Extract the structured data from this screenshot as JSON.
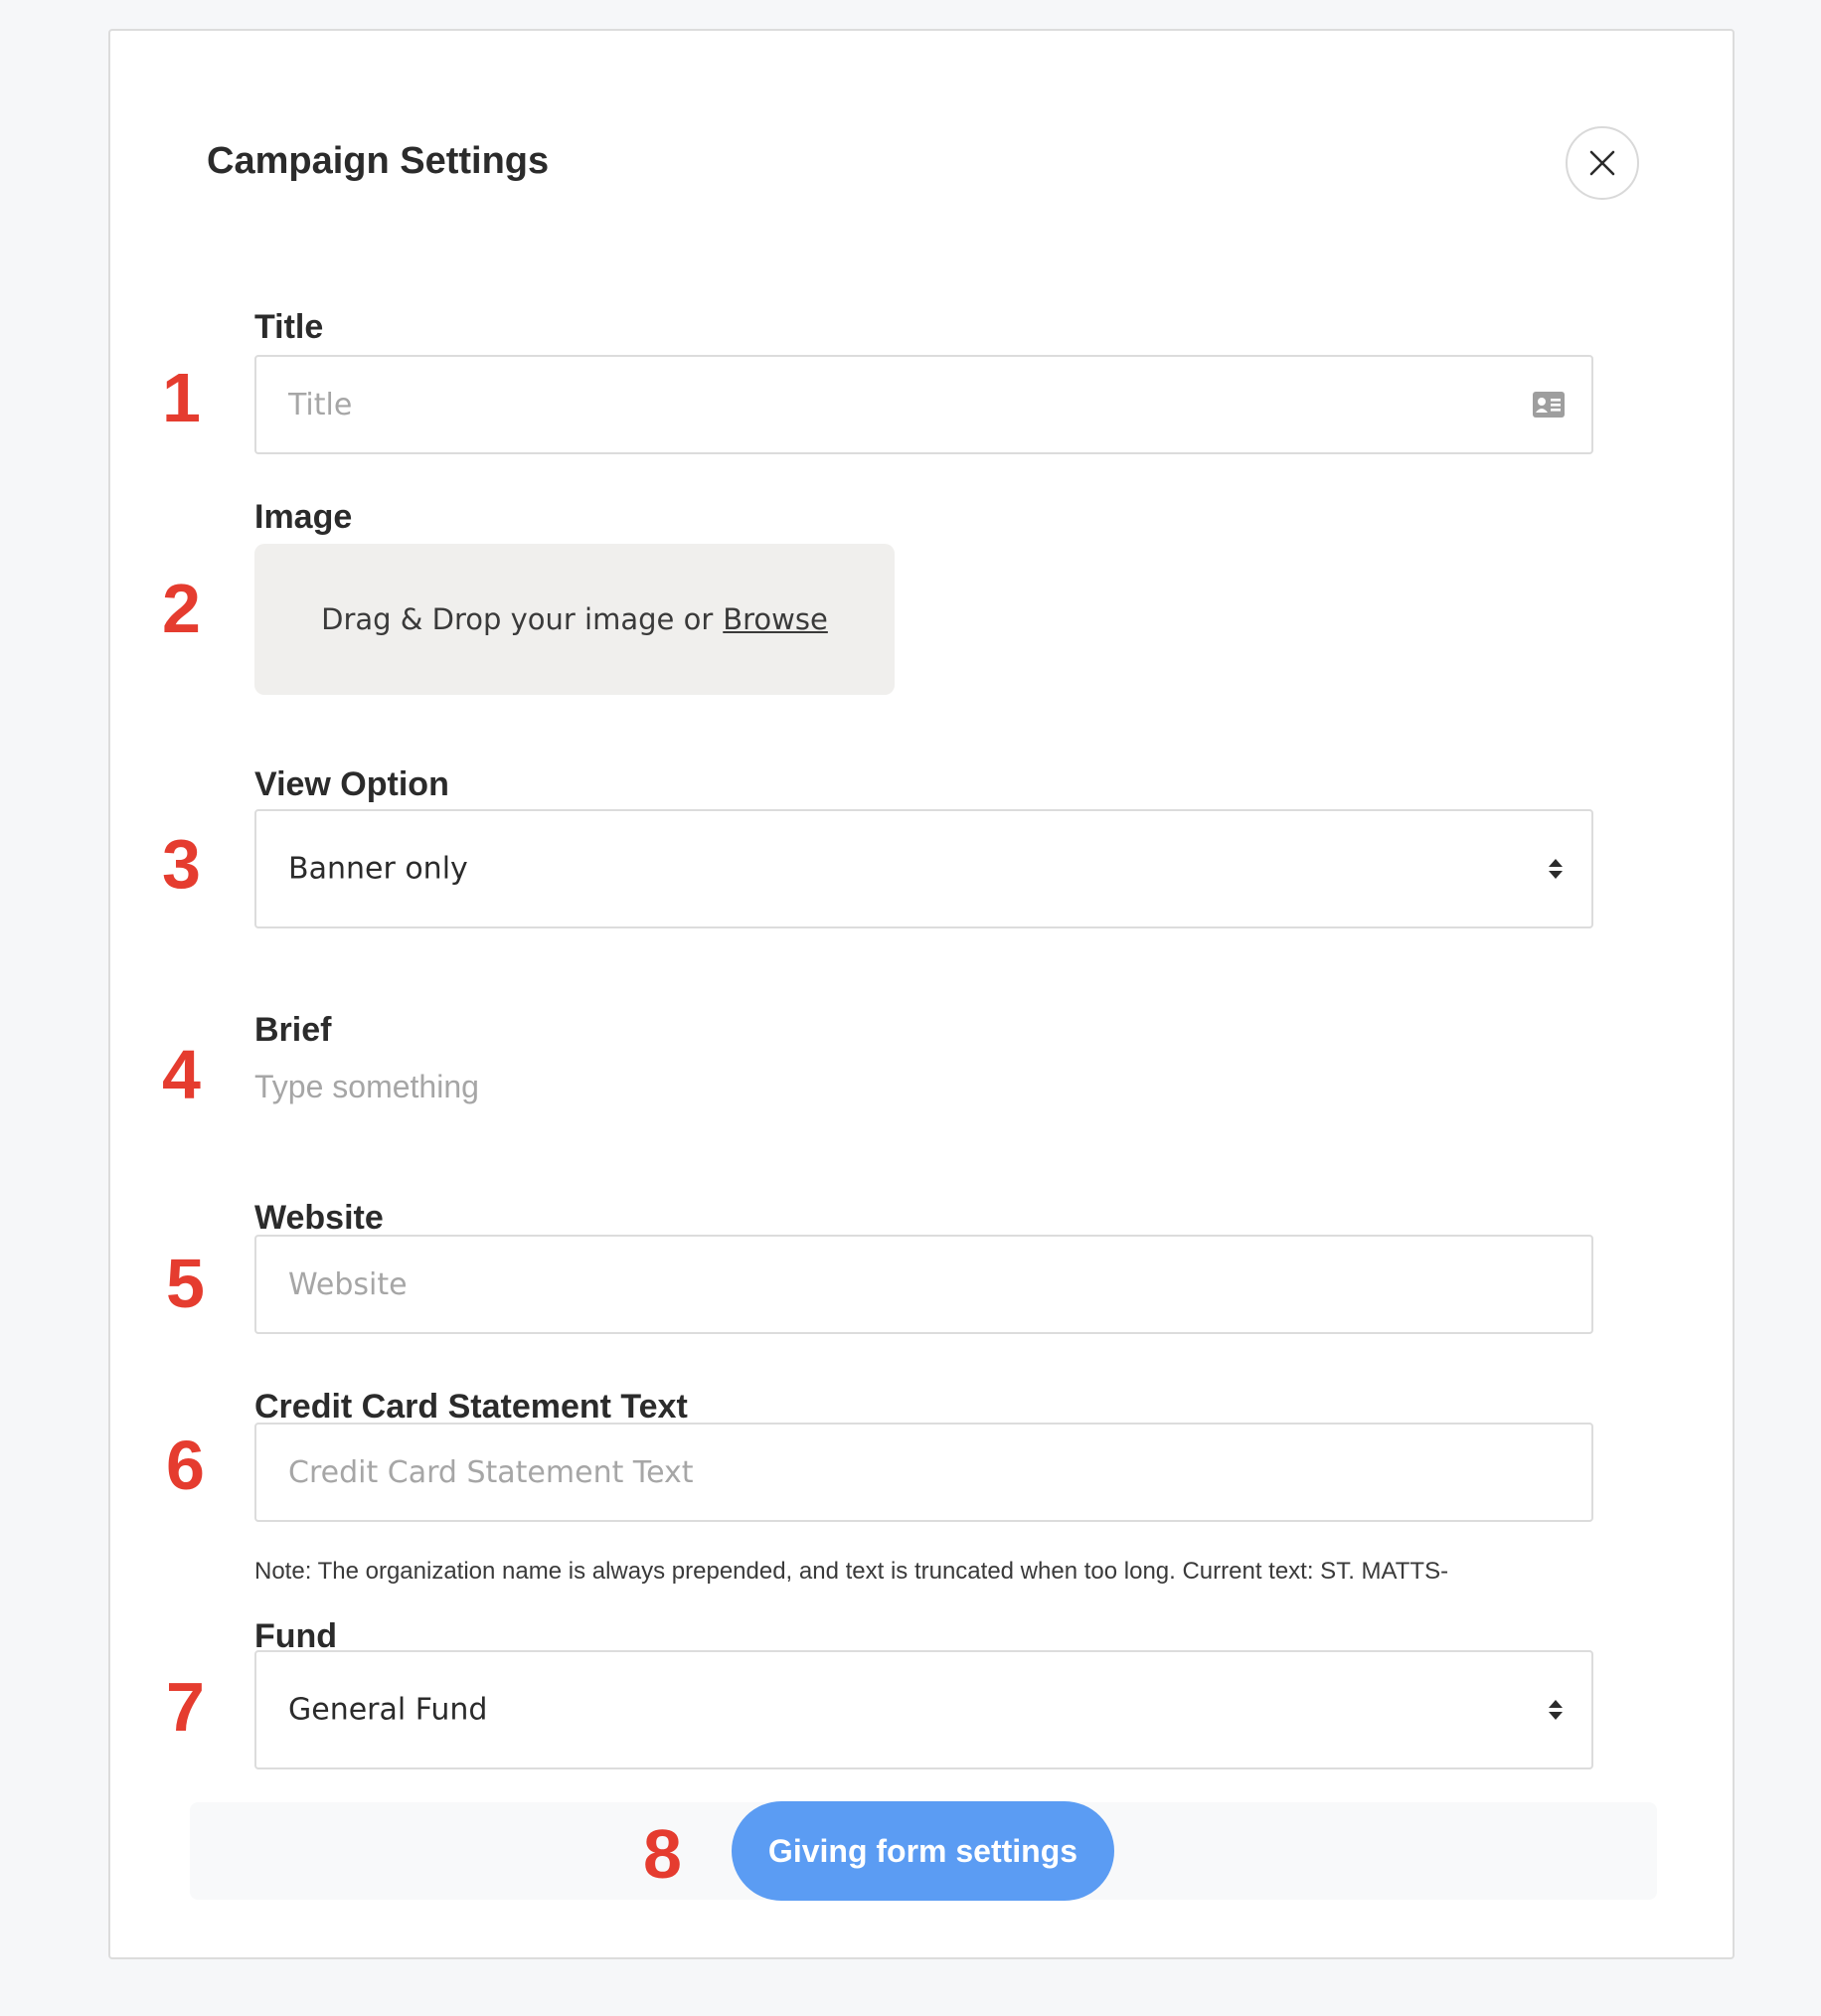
{
  "modal": {
    "title": "Campaign Settings"
  },
  "markers": [
    "1",
    "2",
    "3",
    "4",
    "5",
    "6",
    "7",
    "8"
  ],
  "fields": {
    "title": {
      "label": "Title",
      "placeholder": "Title",
      "value": ""
    },
    "image": {
      "label": "Image",
      "dropzone_text": "Drag & Drop your image or",
      "browse_label": "Browse"
    },
    "view_option": {
      "label": "View Option",
      "selected": "Banner only"
    },
    "brief": {
      "label": "Brief",
      "placeholder": "Type something"
    },
    "website": {
      "label": "Website",
      "placeholder": "Website",
      "value": ""
    },
    "credit_card": {
      "label": "Credit Card Statement Text",
      "placeholder": "Credit Card Statement Text",
      "value": "",
      "note": "Note: The organization name is always prepended, and text is truncated when too long. Current text: ST. MATTS-"
    },
    "fund": {
      "label": "Fund",
      "selected": "General Fund"
    }
  },
  "footer": {
    "primary_button": "Giving form settings"
  },
  "colors": {
    "marker_red": "#e53c2f",
    "primary_blue": "#5b9cf3",
    "dropzone_bg": "#f0efed"
  },
  "icons": {
    "close": "close-icon",
    "title_field": "contact-card-icon",
    "select": "sort-arrows-icon"
  }
}
